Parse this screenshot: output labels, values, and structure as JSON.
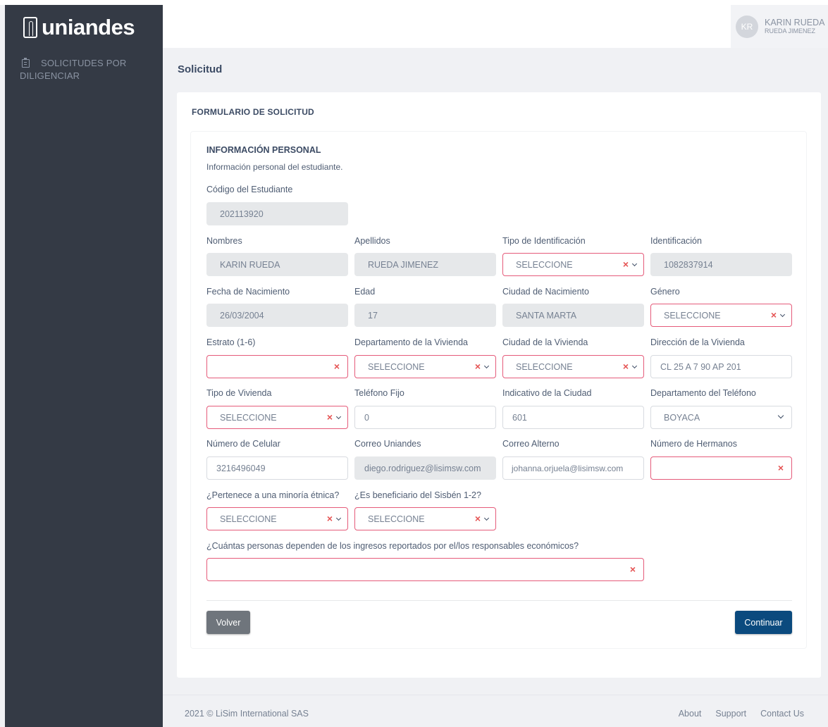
{
  "brand": {
    "name": "uniandes"
  },
  "sidebar": {
    "items": [
      {
        "line1": "SOLICITUDES POR",
        "line2": "DILIGENCIAR",
        "icon": "clipboard-icon"
      }
    ]
  },
  "user": {
    "initials": "KR",
    "name": "KARIN RUEDA",
    "subname": "RUEDA JIMENEZ"
  },
  "page": {
    "title": "Solicitud"
  },
  "card": {
    "title": "FORMULARIO DE SOLICITUD"
  },
  "section": {
    "title": "INFORMACIÓN PERSONAL",
    "subtitle": "Información personal del estudiante."
  },
  "fields": {
    "codigo": {
      "label": "Código del Estudiante",
      "value": "202113920"
    },
    "nombres": {
      "label": "Nombres",
      "value": "KARIN RUEDA"
    },
    "apellidos": {
      "label": "Apellidos",
      "value": "RUEDA JIMENEZ"
    },
    "tipo_id": {
      "label": "Tipo de Identificación",
      "value": "SELECCIONE"
    },
    "identificacion": {
      "label": "Identificación",
      "value": "1082837914"
    },
    "fecha_nac": {
      "label": "Fecha de Nacimiento",
      "value": "26/03/2004"
    },
    "edad": {
      "label": "Edad",
      "value": "17"
    },
    "ciudad_nac": {
      "label": "Ciudad de Nacimiento",
      "value": "SANTA MARTA"
    },
    "genero": {
      "label": "Género",
      "value": "SELECCIONE"
    },
    "estrato": {
      "label": "Estrato (1-6)",
      "value": ""
    },
    "depto_vivienda": {
      "label": "Departamento de la Vivienda",
      "value": "SELECCIONE"
    },
    "ciudad_vivienda": {
      "label": "Ciudad de la Vivienda",
      "value": "SELECCIONE"
    },
    "direccion": {
      "label": "Dirección de la Vivienda",
      "value": "CL 25 A 7 90 AP 201"
    },
    "tipo_vivienda": {
      "label": "Tipo de Vivienda",
      "value": "SELECCIONE"
    },
    "telefono_fijo": {
      "label": "Teléfono Fijo",
      "value": "0"
    },
    "indicativo": {
      "label": "Indicativo de la Ciudad",
      "value": "601"
    },
    "depto_telefono": {
      "label": "Departamento del Teléfono",
      "value": "BOYACA"
    },
    "celular": {
      "label": "Número de Celular",
      "value": "3216496049"
    },
    "correo_uniandes": {
      "label": "Correo Uniandes",
      "value": "diego.rodriguez@lisimsw.com"
    },
    "correo_alterno": {
      "label": "Correo Alterno",
      "value": "johanna.orjuela@lisimsw.com"
    },
    "hermanos": {
      "label": "Número de Hermanos",
      "value": ""
    },
    "minoria": {
      "label": "¿Pertenece a una minoría étnica?",
      "value": "SELECCIONE"
    },
    "sisben": {
      "label": "¿Es beneficiario del Sisbén 1-2?",
      "value": "SELECCIONE"
    },
    "dependientes": {
      "label": "¿Cuántas personas dependen de los ingresos reportados por el/los responsables económicos?",
      "value": ""
    }
  },
  "icons": {
    "clear": "×"
  },
  "buttons": {
    "volver": "Volver",
    "continuar": "Continuar"
  },
  "footer": {
    "copyright": "2021 © LiSim International SAS",
    "links": [
      "About",
      "Support",
      "Contact Us"
    ]
  },
  "colors": {
    "sidebar": "#343a45",
    "primary": "#0b4a7e",
    "secondary": "#6f757c",
    "error": "#e55353"
  }
}
